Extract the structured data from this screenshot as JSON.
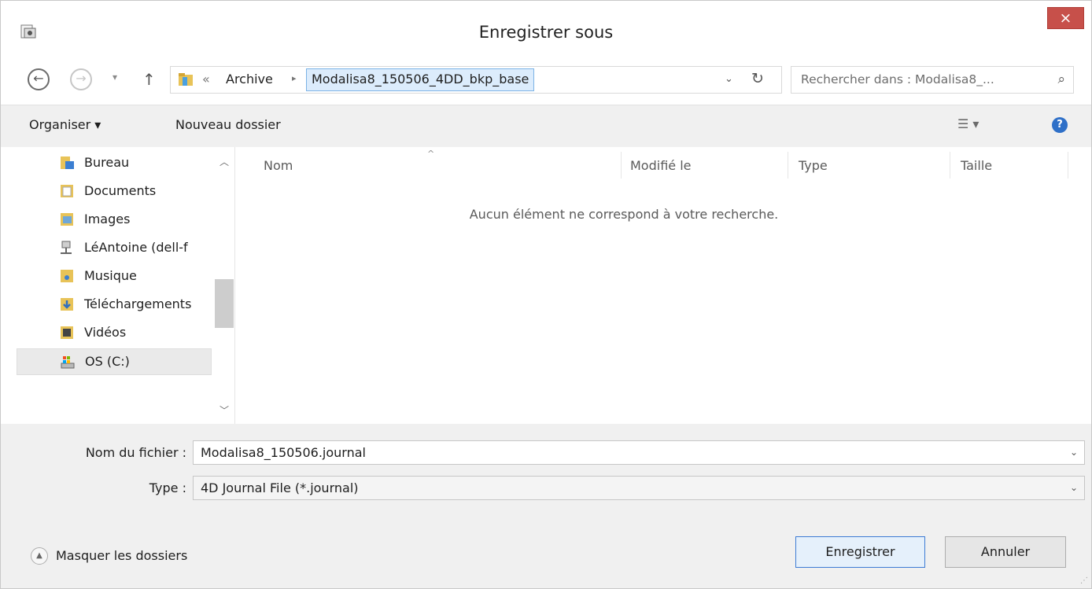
{
  "window": {
    "title": "Enregistrer sous",
    "close_label": "×"
  },
  "nav": {
    "back_glyph": "←",
    "forward_glyph": "→",
    "recent_glyph": "▾",
    "up_glyph": "↑",
    "address": {
      "overflow_glyph": "«",
      "crumb": "Archive",
      "separator_glyph": "▸",
      "current": "Modalisa8_150506_4DD_bkp_base",
      "dropdown_glyph": "⌄",
      "refresh_glyph": "↻"
    },
    "search": {
      "placeholder": "Rechercher dans : Modalisa8_...",
      "icon_glyph": "⌕"
    }
  },
  "toolbar": {
    "organise_label": "Organiser ▾",
    "new_folder_label": "Nouveau dossier",
    "view_glyph": "☰ ▾",
    "help_glyph": "?"
  },
  "sidebar": {
    "items": [
      {
        "label": "Bureau",
        "icon": "desktop-icon"
      },
      {
        "label": "Documents",
        "icon": "documents-icon"
      },
      {
        "label": "Images",
        "icon": "pictures-icon"
      },
      {
        "label": "LéAntoine (dell-f",
        "icon": "network-drive-icon"
      },
      {
        "label": "Musique",
        "icon": "music-icon"
      },
      {
        "label": "Téléchargements",
        "icon": "downloads-icon"
      },
      {
        "label": "Vidéos",
        "icon": "videos-icon"
      },
      {
        "label": "OS (C:)",
        "icon": "drive-icon"
      }
    ],
    "scroll_up_glyph": "︿",
    "scroll_down_glyph": "﹀"
  },
  "content": {
    "columns": [
      "Nom",
      "Modifié le",
      "Type",
      "Taille"
    ],
    "sort_glyph": "^",
    "empty_message": "Aucun élément ne correspond à votre recherche."
  },
  "form": {
    "filename_label": "Nom du fichier :",
    "filename_value": "Modalisa8_150506.journal",
    "type_label": "Type :",
    "type_value": "4D Journal File (*.journal)",
    "dropdown_glyph": "⌄"
  },
  "footer": {
    "hide_folders_label": "Masquer les dossiers",
    "hide_folders_glyph": "▲",
    "save_label": "Enregistrer",
    "cancel_label": "Annuler",
    "grip_glyph": "⋰"
  }
}
